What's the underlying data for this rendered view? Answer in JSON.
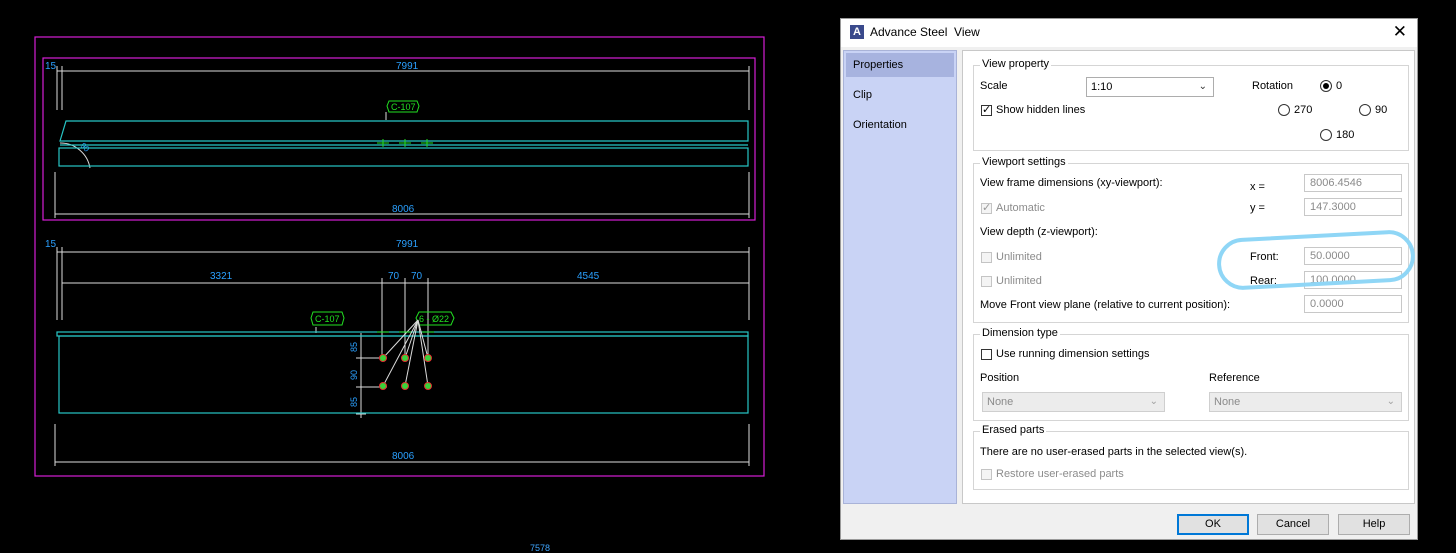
{
  "drawing": {
    "colors": {
      "frame": "#d61fd6",
      "dimension": "#dcdcdc",
      "dimension_text": "#2aa0ff",
      "beam": "#27c6c6",
      "label": "#22e022"
    },
    "top_view": {
      "dim_small": "15",
      "dim_top": "7991",
      "dim_bottom": "8006",
      "label": "C-107",
      "angle_mark": "90"
    },
    "side_view": {
      "dim_small": "15",
      "dim_top": "7991",
      "dim_bottom": "8006",
      "dim_left": "3321",
      "dim_mid1": "70",
      "dim_mid2": "70",
      "dim_right": "4545",
      "label": "C-107",
      "bolt_label": "6 - Ø22",
      "vdim_a": "85",
      "vdim_b": "90",
      "vdim_c": "85"
    },
    "bottom_dim": "7578"
  },
  "dialog": {
    "title": "Advance Steel  View",
    "nav": [
      "Properties",
      "Clip",
      "Orientation"
    ],
    "view_property": {
      "title": "View property",
      "scale_label": "Scale",
      "scale_value": "1:10",
      "rotation_label": "Rotation",
      "rotations": [
        "0",
        "270",
        "90",
        "180"
      ],
      "selected_rotation": "0",
      "show_hidden_lines": "Show hidden lines"
    },
    "viewport": {
      "title": "Viewport settings",
      "frame_label": "View frame dimensions (xy-viewport):",
      "x_label": "x =",
      "x_value": "8006.4546",
      "y_label": "y =",
      "y_value": "147.3000",
      "automatic": "Automatic",
      "depth_label": "View depth (z-viewport):",
      "unlimited1": "Unlimited",
      "unlimited2": "Unlimited",
      "front_label": "Front:",
      "front_value": "50.0000",
      "rear_label": "Rear:",
      "rear_value": "100.0000",
      "move_label": "Move Front view plane (relative to current position):",
      "move_value": "0.0000"
    },
    "dimension_type": {
      "title": "Dimension type",
      "running": "Use running dimension settings",
      "position_label": "Position",
      "position_value": "None",
      "reference_label": "Reference",
      "reference_value": "None"
    },
    "erased": {
      "title": "Erased parts",
      "message": "There are no user-erased parts in the selected view(s).",
      "restore": "Restore user-erased parts"
    },
    "buttons": {
      "ok": "OK",
      "cancel": "Cancel",
      "help": "Help"
    },
    "icons": {
      "app": "advance-steel-logo-icon",
      "close": "close-icon",
      "dropdown": "chevron-down-icon"
    }
  }
}
